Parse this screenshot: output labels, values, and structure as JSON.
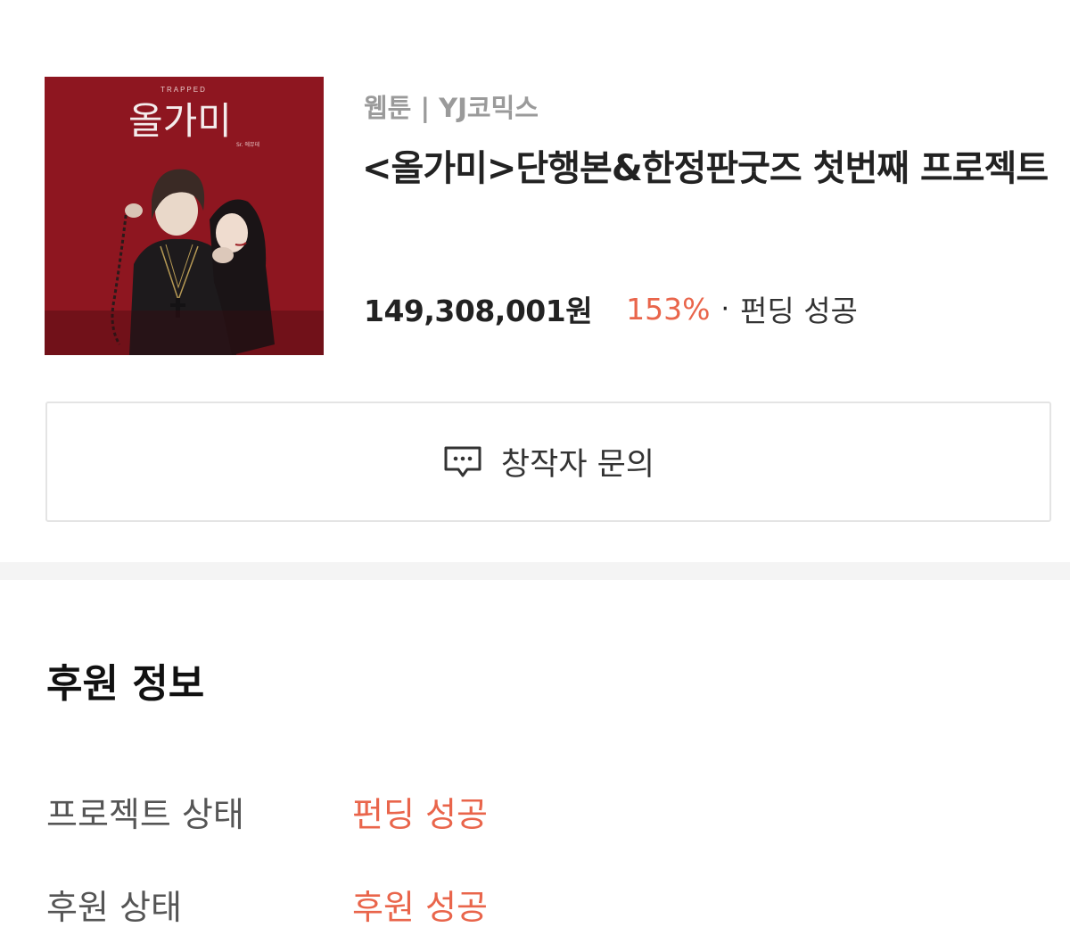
{
  "project": {
    "cover": {
      "title_en": "TRAPPED",
      "title_ko": "올가미",
      "caption": "Sr. 에뮤데",
      "bg_color": "#8e1620"
    },
    "meta": "웹툰 | YJ코믹스",
    "title": "<올가미>단행본&한정판굿즈 첫번째 프로젝트",
    "amount": "149,308,001원",
    "percent": "153%",
    "separator": "·",
    "status": "펀딩 성공"
  },
  "inquiry_button": {
    "label": "창작자 문의",
    "icon": "chat-bubble-icon"
  },
  "sponsor_info": {
    "title": "후원 정보",
    "rows": [
      {
        "label": "프로젝트 상태",
        "value": "펀딩 성공"
      },
      {
        "label": "후원 상태",
        "value": "후원 성공"
      }
    ]
  },
  "colors": {
    "accent": "#e9654b",
    "divider": "#f4f4f4",
    "border": "#e4e4e4"
  }
}
